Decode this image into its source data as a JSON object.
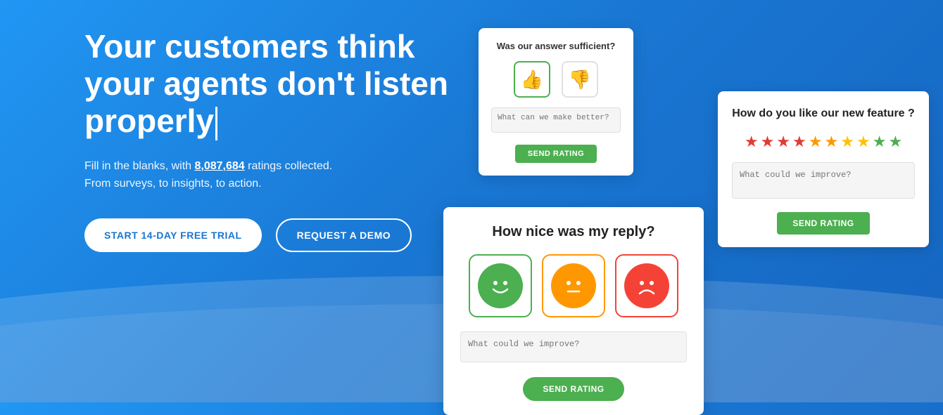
{
  "hero": {
    "heading_line1": "Your customers think",
    "heading_line2": "your agents don't listen",
    "heading_line3": "properly",
    "subtitle_prefix": "Fill in the blanks, with ",
    "subtitle_number": "8,087,684",
    "subtitle_suffix": " ratings collected.",
    "subtitle_line2": "From surveys, to insights, to action.",
    "btn_trial": "START 14-DAY FREE TRIAL",
    "btn_demo": "REQUEST A DEMO"
  },
  "card_thumbs": {
    "title": "Was our answer sufficient?",
    "textarea_placeholder": "What can we make better?",
    "send_label": "SEND RATING",
    "thumb_up": "👍",
    "thumb_down": "👎"
  },
  "card_stars": {
    "title": "How do you like our new feature ?",
    "stars": [
      "★",
      "★",
      "★",
      "★",
      "★",
      "★",
      "★",
      "★",
      "★",
      "★"
    ],
    "star_colors": [
      "filled-red",
      "filled-red",
      "filled-red",
      "filled-red",
      "filled-orange",
      "filled-orange",
      "filled-yellow",
      "filled-yellow",
      "filled-green",
      "filled-green"
    ],
    "textarea_placeholder": "What could we improve?",
    "send_label": "SEND RATING"
  },
  "card_smiley": {
    "title": "How nice was my reply?",
    "faces": [
      "😊",
      "😐",
      "☹"
    ],
    "face_types": [
      "happy",
      "neutral",
      "sad"
    ],
    "textarea_placeholder": "What could we improve?",
    "send_label": "SEND RATING"
  }
}
